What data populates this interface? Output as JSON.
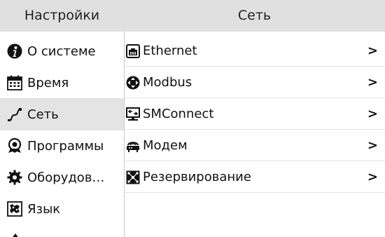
{
  "header": {
    "left_title": "Настройки",
    "right_title": "Сеть"
  },
  "sidebar": {
    "items": [
      {
        "label": "О системе",
        "icon": "info-icon"
      },
      {
        "label": "Время",
        "icon": "calendar-icon"
      },
      {
        "label": "Сеть",
        "icon": "network-cable-icon",
        "selected": true
      },
      {
        "label": "Программы",
        "icon": "programs-icon"
      },
      {
        "label": "Оборудов…",
        "icon": "gear-icon"
      },
      {
        "label": "Язык",
        "icon": "map-icon"
      }
    ]
  },
  "network": {
    "items": [
      {
        "label": "Ethernet",
        "icon": "ethernet-icon",
        "arrow": ">"
      },
      {
        "label": "Modbus",
        "icon": "modbus-icon",
        "arrow": ">"
      },
      {
        "label": "SMConnect",
        "icon": "smconnect-icon",
        "arrow": ">"
      },
      {
        "label": "Модем",
        "icon": "modem-icon",
        "arrow": ">"
      },
      {
        "label": "Резервирование",
        "icon": "redundancy-icon",
        "arrow": ">"
      }
    ]
  },
  "colors": {
    "header_bg": "#e0e0e0",
    "selected_bg": "#e4e4e4",
    "text": "#111111"
  }
}
